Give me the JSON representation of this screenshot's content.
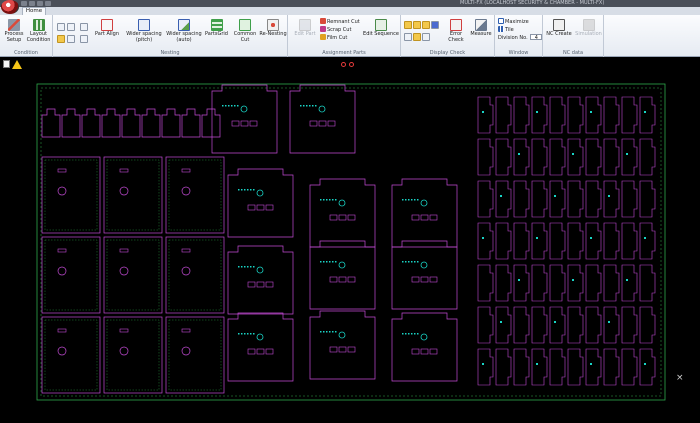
{
  "window": {
    "title": "MULTI-FX (LOCALHOST SECURITY & CHAMBER - MULTI-FX)"
  },
  "tabs": [
    {
      "label": "Home",
      "active": true
    }
  ],
  "ribbon": {
    "groups": [
      {
        "name": "condition",
        "label": "Condition"
      },
      {
        "name": "nesting",
        "label": "Nesting"
      },
      {
        "name": "assignment-parts",
        "label": "Assignment Parts"
      },
      {
        "name": "display-check",
        "label": "Display Check"
      },
      {
        "name": "window",
        "label": "Window"
      },
      {
        "name": "nc-data",
        "label": "NC data"
      }
    ],
    "buttons": {
      "process_setup": "Process Setup",
      "layout_condition": "Layout Condition",
      "part_align": "Part Align",
      "wider_pitch": "Wider spacing (pitch)",
      "wider_auto": "Wider spacing (auto)",
      "partsgrid": "PartsGrid",
      "common_cut": "Common Cut",
      "re_nesting": "Re-Nesting",
      "edit_part": "Edit Part",
      "remnant_cut": "Remnant Cut",
      "scrap_cut": "Scrap Cut",
      "film_cut": "Film Cut",
      "edit_sequence": "Edit Sequence",
      "error_check": "Error Check",
      "measure": "Measure",
      "maximize": "Maximize",
      "tile": "Tile",
      "division_no_label": "Division No.",
      "division_no_value": "4",
      "nc_create": "NC Create",
      "simulation": "Simulation"
    }
  },
  "canvas": {
    "close_glyph": "×",
    "colors": {
      "part": "#c44bd6",
      "border": "#2fa84a",
      "dots": "#19d3c5"
    }
  }
}
